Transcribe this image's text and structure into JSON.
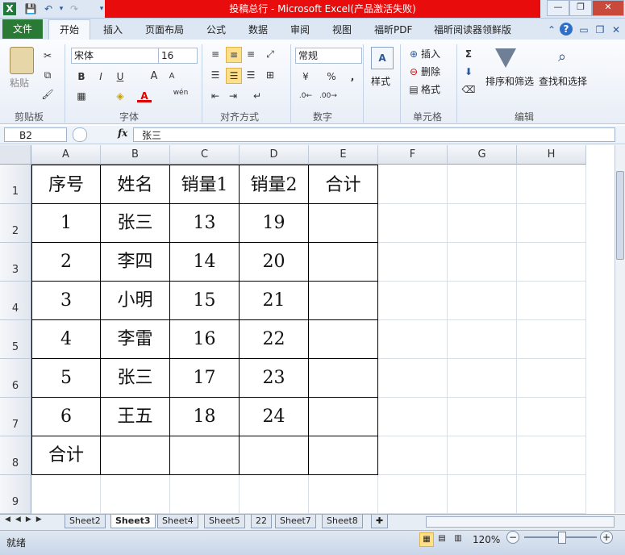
{
  "window": {
    "title": "投稿总行 - Microsoft Excel(产品激活失败)"
  },
  "ribbon_tabs": [
    "文件",
    "开始",
    "插入",
    "页面布局",
    "公式",
    "数据",
    "审阅",
    "视图",
    "福昕PDF",
    "福昕阅读器领鲜版"
  ],
  "clipboard": {
    "paste": "粘贴",
    "group": "剪贴板"
  },
  "font": {
    "name": "宋体",
    "size": "16",
    "group": "字体",
    "bold": "B",
    "italic": "I",
    "underline": "U",
    "grow": "A",
    "shrink": "A",
    "color_a": "A",
    "wen": "wén"
  },
  "alignment": {
    "group": "对齐方式"
  },
  "number": {
    "format": "常规",
    "group": "数字",
    "percent": "%",
    "comma": ","
  },
  "styles": {
    "label": "样式"
  },
  "cells": {
    "insert": "插入",
    "delete": "删除",
    "format": "格式",
    "group": "单元格"
  },
  "editing": {
    "sigma": "Σ",
    "sort": "排序和筛选",
    "find": "查找和选择",
    "group": "编辑"
  },
  "formula_bar": {
    "namebox": "B2",
    "fx": "fx",
    "content": "张三"
  },
  "columns": [
    "A",
    "B",
    "C",
    "D",
    "E",
    "F",
    "G",
    "H"
  ],
  "rows": [
    "1",
    "2",
    "3",
    "4",
    "5",
    "6",
    "7",
    "8",
    "9"
  ],
  "table": {
    "header": [
      "序号",
      "姓名",
      "销量1",
      "销量2",
      "合计"
    ],
    "rows": [
      [
        "1",
        "张三",
        "13",
        "19",
        ""
      ],
      [
        "2",
        "李四",
        "14",
        "20",
        ""
      ],
      [
        "3",
        "小明",
        "15",
        "21",
        ""
      ],
      [
        "4",
        "李雷",
        "16",
        "22",
        ""
      ],
      [
        "5",
        "张三",
        "17",
        "23",
        ""
      ],
      [
        "6",
        "王五",
        "18",
        "24",
        ""
      ]
    ],
    "total_row": [
      "合计",
      "",
      "",
      "",
      ""
    ]
  },
  "sheets": [
    "Sheet2",
    "Sheet3",
    "Sheet4",
    "Sheet5",
    "22",
    "Sheet7",
    "Sheet8"
  ],
  "active_sheet": "Sheet3",
  "status": {
    "ready": "就绪",
    "zoom": "120%",
    "minus": "−",
    "plus": "+"
  },
  "colors": {
    "title_bar": "#e80c0c",
    "file_tab": "#2a7a35",
    "selected_button": "#ffe08a"
  }
}
